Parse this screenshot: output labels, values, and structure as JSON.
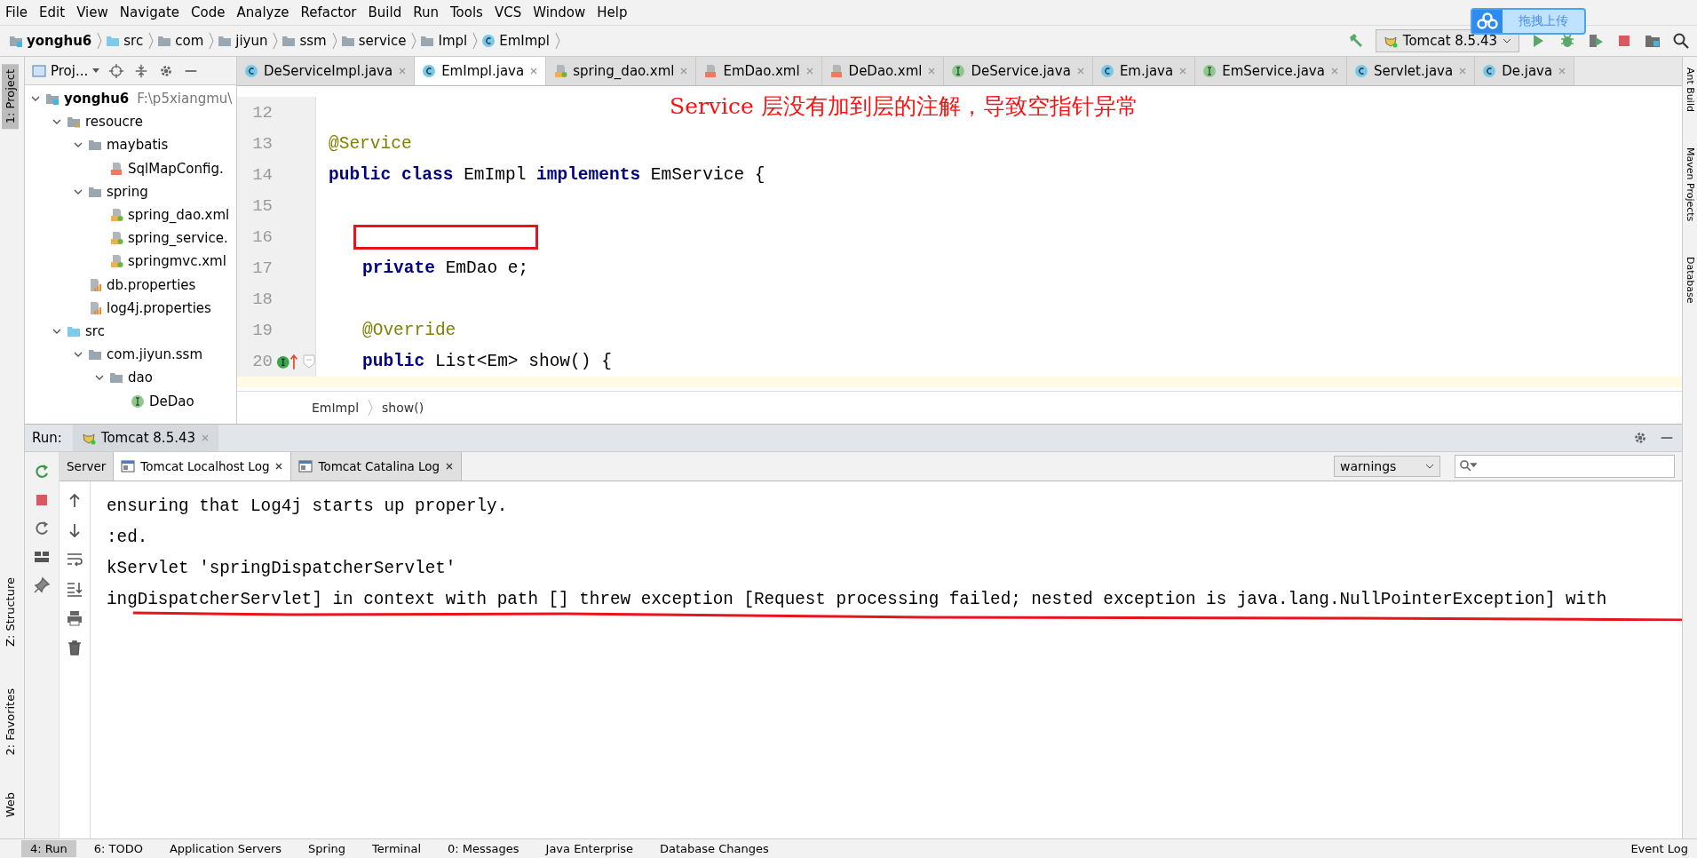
{
  "menu": [
    "File",
    "Edit",
    "View",
    "Navigate",
    "Code",
    "Analyze",
    "Refactor",
    "Build",
    "Run",
    "Tools",
    "VCS",
    "Window",
    "Help"
  ],
  "breadcrumbs": [
    {
      "label": "yonghu6",
      "kind": "module"
    },
    {
      "label": "src",
      "kind": "source"
    },
    {
      "label": "com",
      "kind": "folder"
    },
    {
      "label": "jiyun",
      "kind": "folder"
    },
    {
      "label": "ssm",
      "kind": "folder"
    },
    {
      "label": "service",
      "kind": "folder"
    },
    {
      "label": "Impl",
      "kind": "folder"
    },
    {
      "label": "EmImpl",
      "kind": "class"
    }
  ],
  "run_config": "Tomcat 8.5.43",
  "upload_badge": "拖拽上传",
  "left_stripe": [
    {
      "label": "1: Project",
      "selected": true
    },
    {
      "label": "Z: Structure",
      "selected": false
    },
    {
      "label": "2: Favorites",
      "selected": false
    },
    {
      "label": "Web",
      "selected": false
    }
  ],
  "right_stripe": [
    "Ant Build",
    "Maven Projects",
    "Database"
  ],
  "project_panel": {
    "title": "Proj...",
    "tree": [
      {
        "label": "yonghu6",
        "path": "F:\\p5xiangmu\\",
        "kind": "module",
        "expanded": true,
        "children": [
          {
            "label": "resoucre",
            "kind": "resource",
            "expanded": true,
            "children": [
              {
                "label": "maybatis",
                "kind": "folder",
                "expanded": true,
                "children": [
                  {
                    "label": "SqlMapConfig.",
                    "kind": "xml"
                  }
                ]
              },
              {
                "label": "spring",
                "kind": "folder",
                "expanded": true,
                "children": [
                  {
                    "label": "spring_dao.xml",
                    "kind": "spring-xml"
                  },
                  {
                    "label": "spring_service.",
                    "kind": "spring-xml"
                  },
                  {
                    "label": "springmvc.xml",
                    "kind": "spring-xml"
                  }
                ]
              },
              {
                "label": "db.properties",
                "kind": "properties"
              },
              {
                "label": "log4j.properties",
                "kind": "properties"
              }
            ]
          },
          {
            "label": "src",
            "kind": "source",
            "expanded": true,
            "children": [
              {
                "label": "com.jiyun.ssm",
                "kind": "folder",
                "expanded": true,
                "children": [
                  {
                    "label": "dao",
                    "kind": "folder",
                    "expanded": true,
                    "children": [
                      {
                        "label": "DeDao",
                        "kind": "interface"
                      }
                    ]
                  }
                ]
              }
            ]
          }
        ]
      }
    ]
  },
  "editor_tabs": [
    {
      "label": "DeServiceImpl.java",
      "kind": "class",
      "selected": false
    },
    {
      "label": "EmImpl.java",
      "kind": "class",
      "selected": true
    },
    {
      "label": "spring_dao.xml",
      "kind": "spring-xml",
      "selected": false
    },
    {
      "label": "EmDao.xml",
      "kind": "xml",
      "selected": false
    },
    {
      "label": "DeDao.xml",
      "kind": "xml",
      "selected": false
    },
    {
      "label": "DeService.java",
      "kind": "interface",
      "selected": false
    },
    {
      "label": "Em.java",
      "kind": "class",
      "selected": false
    },
    {
      "label": "EmService.java",
      "kind": "interface",
      "selected": false
    },
    {
      "label": "Servlet.java",
      "kind": "class",
      "selected": false
    },
    {
      "label": "De.java",
      "kind": "class",
      "selected": false
    }
  ],
  "annotation_note": "Service 层没有加到层的注解，导致空指针异常",
  "code_lines": [
    {
      "number": "12"
    },
    {
      "number": "13",
      "indented": false,
      "tokens": [
        {
          "kind": "annotation",
          "text": "@Service"
        }
      ]
    },
    {
      "number": "14",
      "indented": false,
      "tokens": [
        {
          "kind": "keyword",
          "text": "public class"
        },
        {
          "kind": "plain",
          "text": "EmImpl"
        },
        {
          "kind": "keyword",
          "text": "implements"
        },
        {
          "kind": "plain",
          "text": "EmService {"
        }
      ]
    },
    {
      "number": "15"
    },
    {
      "number": "16",
      "indented": true,
      "marked": true
    },
    {
      "number": "17",
      "indented": true,
      "tokens": [
        {
          "kind": "keyword",
          "text": "private"
        },
        {
          "kind": "plain",
          "text": "EmDao e;"
        }
      ]
    },
    {
      "number": "18"
    },
    {
      "number": "19",
      "indented": true,
      "tokens": [
        {
          "kind": "annotation",
          "text": "@Override"
        }
      ]
    },
    {
      "number": "20",
      "indented": true,
      "gutter_mark": true,
      "tokens": [
        {
          "kind": "keyword",
          "text": "public"
        },
        {
          "kind": "plain",
          "text": "List<Em> show() {"
        }
      ]
    }
  ],
  "editor_breadcrumbs": [
    "EmImpl",
    "show()"
  ],
  "run_panel": {
    "label": "Run:",
    "tab": "Tomcat 8.5.43",
    "log_tabs": [
      {
        "label": "Server",
        "closable": false,
        "selected": false
      },
      {
        "label": "Tomcat Localhost Log",
        "closable": true,
        "selected": true
      },
      {
        "label": "Tomcat Catalina Log",
        "closable": true,
        "selected": false
      }
    ],
    "filter": "warnings",
    "log_lines": [
      {
        "text": "ensuring that Log4j starts up properly."
      },
      {
        "text": ":ed."
      },
      {
        "text": "kServlet 'springDispatcherServlet'"
      },
      {
        "text": "ingDispatcherServlet] in context with path [] threw exception [Request processing failed; nested exception is java.lang.NullPointerException] with",
        "underlined": true
      }
    ]
  },
  "bottom_bar": [
    {
      "label": "4: Run",
      "selected": true
    },
    {
      "label": "6: TODO",
      "selected": false
    },
    {
      "label": "Application Servers",
      "selected": false
    },
    {
      "label": "Spring",
      "selected": false
    },
    {
      "label": "Terminal",
      "selected": false
    },
    {
      "label": "0: Messages",
      "selected": false
    },
    {
      "label": "Java Enterprise",
      "selected": false
    },
    {
      "label": "Database Changes",
      "selected": false
    }
  ],
  "event_log": "Event Log"
}
